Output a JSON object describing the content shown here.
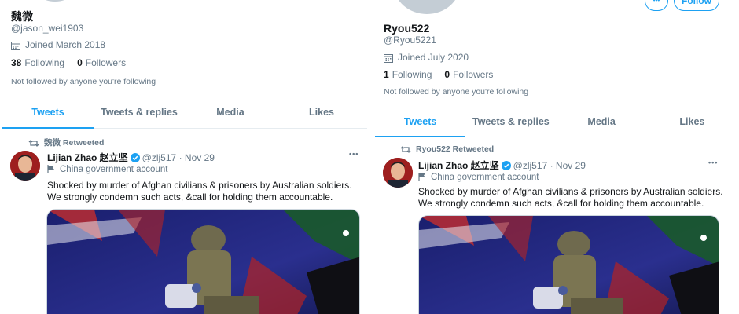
{
  "left": {
    "display_name": "魏微",
    "handle": "@jason_wei1903",
    "joined": "Joined March 2018",
    "following_count": "38",
    "following_label": "Following",
    "followers_count": "0",
    "followers_label": "Followers",
    "not_followed": "Not followed by anyone you're following",
    "tabs": [
      "Tweets",
      "Tweets & replies",
      "Media",
      "Likes"
    ],
    "active_tab": "Tweets",
    "retweeted_by": "魏微 Retweeted",
    "tweet": {
      "author": "Lijian Zhao 赵立坚",
      "handle": "@zlj517",
      "sep": "·",
      "date": "Nov 29",
      "label": "China government account",
      "text": "Shocked by murder of Afghan civilians & prisoners by Australian soldiers. We strongly condemn such acts, &call for holding them accountable.",
      "more": "•••"
    }
  },
  "right": {
    "display_name": "Ryou522",
    "handle": "@Ryou5221",
    "joined": "Joined July 2020",
    "following_count": "1",
    "following_label": "Following",
    "followers_count": "0",
    "followers_label": "Followers",
    "not_followed": "Not followed by anyone you're following",
    "follow_button": "Follow",
    "more_button": "•••",
    "tabs": [
      "Tweets",
      "Tweets & replies",
      "Media",
      "Likes"
    ],
    "active_tab": "Tweets",
    "retweeted_by": "Ryou522 Retweeted",
    "tweet": {
      "author": "Lijian Zhao 赵立坚",
      "handle": "@zlj517",
      "sep": "·",
      "date": "Nov 29",
      "label": "China government account",
      "text": "Shocked by murder of Afghan civilians & prisoners by Australian soldiers. We strongly condemn such acts, &call for holding them accountable.",
      "more": "•••"
    }
  },
  "colors": {
    "accent": "#1da1f2",
    "muted": "#657786",
    "text": "#14171a",
    "border": "#e6ecf0"
  },
  "icons": {
    "calendar": "calendar-icon",
    "retweet": "retweet-icon",
    "verified": "verified-badge-icon",
    "flag": "flag-icon"
  }
}
